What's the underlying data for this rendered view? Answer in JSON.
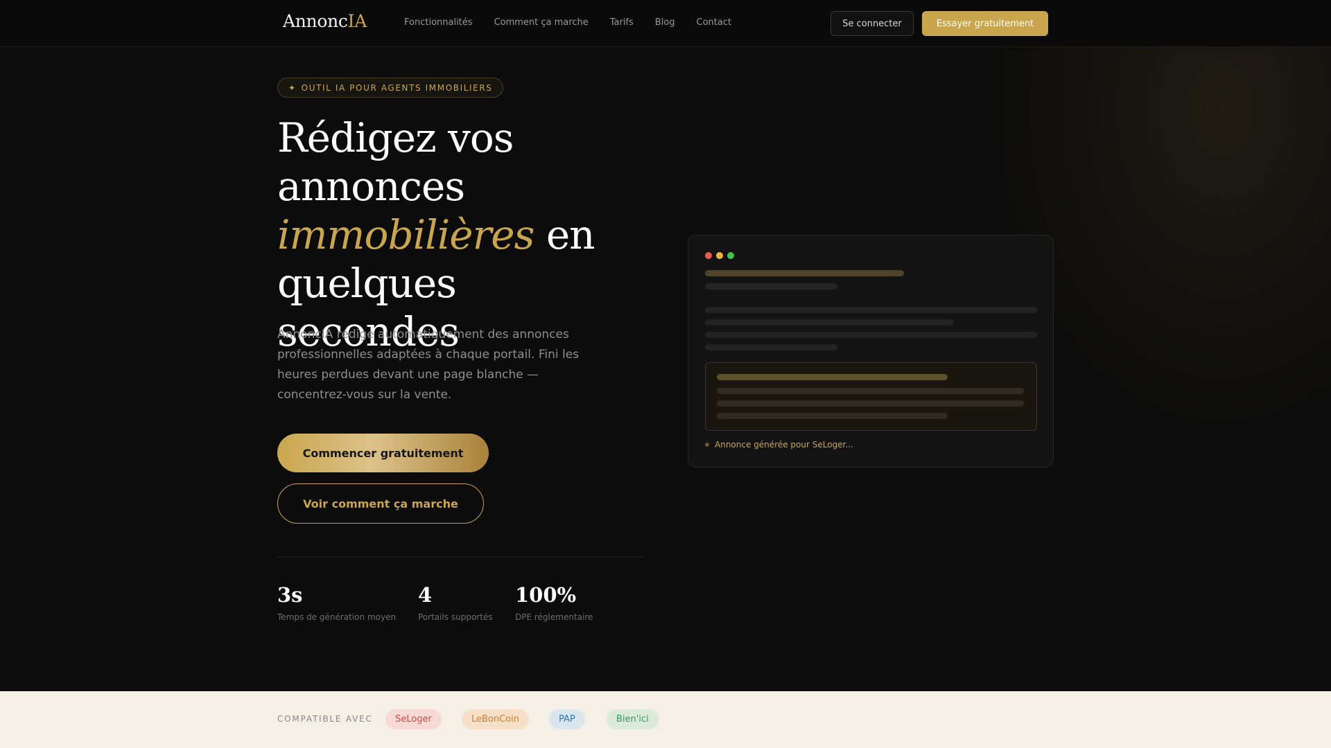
{
  "nav": {
    "logo_main": "Annonc",
    "logo_accent": "IA",
    "links": [
      "Fonctionnalités",
      "Comment ça marche",
      "Tarifs",
      "Blog",
      "Contact"
    ],
    "login_label": "Se connecter",
    "try_label": "Essayer gratuitement"
  },
  "hero": {
    "badge_icon": "✦",
    "badge_text": "OUTIL IA POUR AGENTS IMMOBILIERS",
    "title_line1": "Rédigez vos",
    "title_line2": "annonces",
    "title_accent": "immobilières",
    "title_after_accent": " en",
    "title_line4": "quelques secondes",
    "description": "AnnoncIA rédige automatiquement des annonces professionnelles adaptées à chaque portail. Fini les heures perdues devant une page blanche — concentrez-vous sur la vente.",
    "cta_primary": "Commencer gratuitement",
    "cta_secondary": "Voir comment ça marche"
  },
  "stats": [
    {
      "value": "3s",
      "label": "Temps de génération moyen"
    },
    {
      "value": "4",
      "label": "Portails supportés"
    },
    {
      "value": "100%",
      "label": "DPE réglementaire"
    }
  ],
  "mockup": {
    "status_text": "Annonce générée pour SeLoger..."
  },
  "compat": {
    "label": "COMPATIBLE AVEC",
    "portals": [
      "SeLoger",
      "LeBonCoin",
      "PAP",
      "Bien'ici"
    ]
  },
  "colors": {
    "accent": "#c9a64e",
    "background": "#0c0c0c",
    "compat_background": "#f4efe7"
  }
}
